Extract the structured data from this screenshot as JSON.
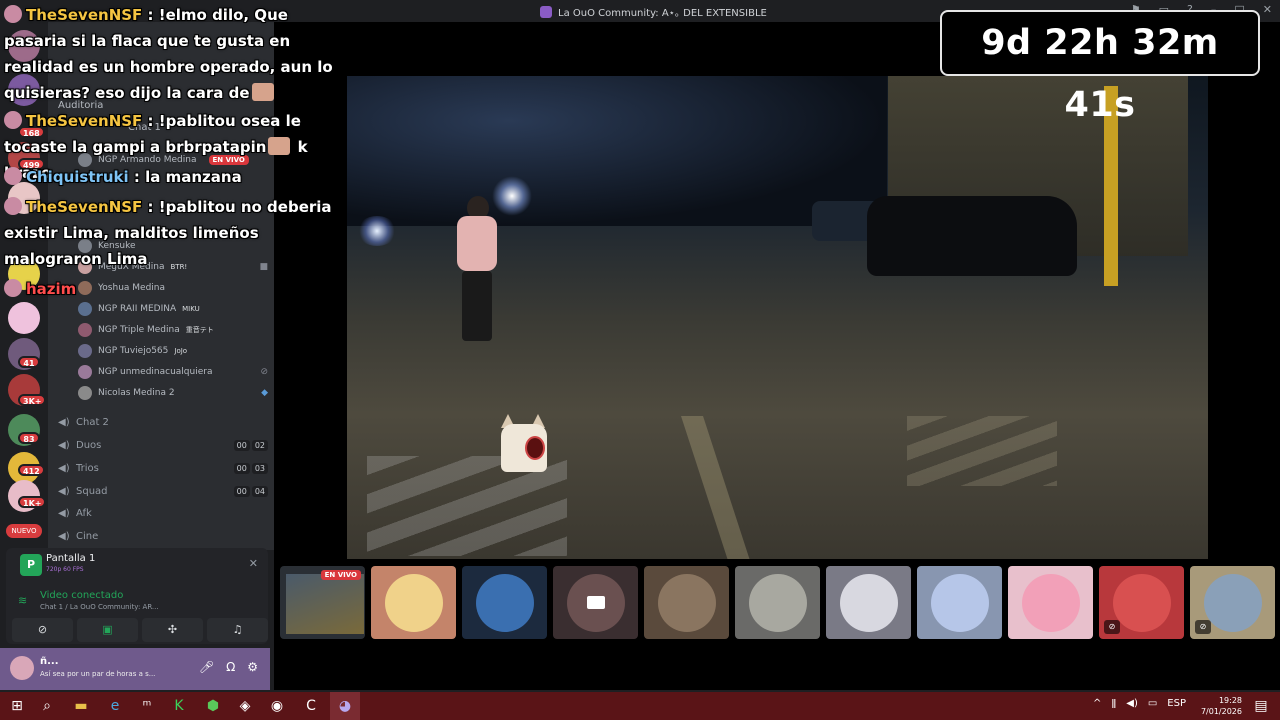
{
  "window": {
    "title": "La OuO Community: A⋆｡ DEL EXTENSIBLE"
  },
  "countdown": "9d 22h 32m 41s",
  "chat_messages": [
    {
      "user": "TheSevenNSF",
      "user_color": "#f5c542",
      "text": ": !elmo dilo, Que pasaria si la flaca que te gusta en realidad es un hombre operado, aun lo quisieras? eso dijo la cara de"
    },
    {
      "user": "TheSevenNSF",
      "user_color": "#f5c542",
      "text": ": !pablitou osea le tocaste la gampi a brbrpatapin",
      "tail": "k brazo"
    },
    {
      "user": "Chiquistruki",
      "user_color": "#7ec3f5",
      "text": ": la manzana"
    },
    {
      "user": "TheSevenNSF",
      "user_color": "#f5c542",
      "text": ": !pablitou no deberia existir Lima, malditos limeños malograron Lima"
    },
    {
      "user": "hazim",
      "user_color": "#ff4d4d",
      "text": ""
    }
  ],
  "sidebar": {
    "members_stage": [
      {
        "name": "NGP Armando Medina",
        "live": "EN VIVO"
      },
      {
        "name": "Kensuke"
      },
      {
        "name": "MeguX Medina",
        "tag": "BTR!"
      },
      {
        "name": "Yoshua Medina"
      },
      {
        "name": "NGP RAII MEDINA",
        "tag": "MIKU"
      },
      {
        "name": "NGP Triple Medina",
        "tag": "重音テト"
      },
      {
        "name": "NGP Tuviejo565",
        "tag": "JoJo"
      },
      {
        "name": "NGP unmedinacualquiera"
      },
      {
        "name": "Nicolas Medina 2"
      }
    ],
    "channels": [
      {
        "name": "Chat 2"
      },
      {
        "name": "Duos",
        "count_a": "00",
        "count_b": "02"
      },
      {
        "name": "Trios",
        "count_a": "00",
        "count_b": "03"
      },
      {
        "name": "Squad",
        "count_a": "00",
        "count_b": "04"
      },
      {
        "name": "Afk"
      },
      {
        "name": "Cine"
      }
    ],
    "header_auditoria": "Auditoria",
    "header_chat1": "Chat 1"
  },
  "rail": {
    "badges": [
      "168",
      "499",
      "41",
      "3K+",
      "83",
      "412",
      "1K+"
    ],
    "new_label": "NUEVO"
  },
  "voice_panel": {
    "screen_name": "Pantalla 1",
    "screen_quality": "720p 60 FPS",
    "status": "Video conectado",
    "channel": "Chat 1 / La OuO Community: AR...",
    "user_status": "Así sea por un par de horas a s..."
  },
  "tiles": {
    "live_label": "EN VIVO"
  },
  "taskbar": {
    "lang": "ESP",
    "time": "19:28",
    "date": "7/01/2026"
  }
}
